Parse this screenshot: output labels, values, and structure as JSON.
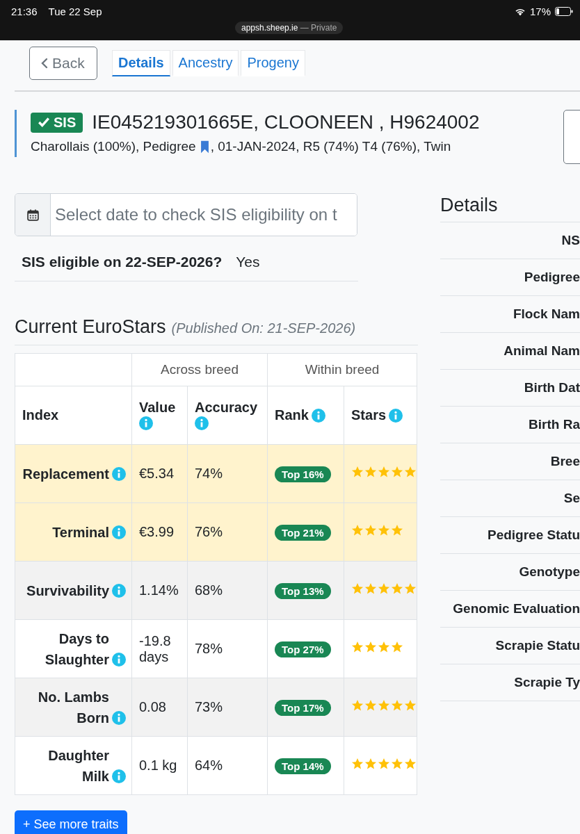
{
  "status_bar": {
    "time": "21:36",
    "date": "Tue 22 Sep",
    "battery": "17%",
    "url": "appsh.sheep.ie",
    "url_note": "— Private"
  },
  "nav": {
    "back": "Back",
    "tabs": [
      {
        "label": "Details",
        "selected": true
      },
      {
        "label": "Ancestry",
        "selected": false
      },
      {
        "label": "Progeny",
        "selected": false
      }
    ]
  },
  "animal": {
    "badge": "SIS",
    "title": "IE045219301665E, CLOONEEN , H9624002",
    "summary_before": "Charollais (100%), Pedigree",
    "summary_after": ", 01-JAN-2024, R5 (74%) T4 (76%), Twin"
  },
  "date_field": {
    "placeholder": "Select date to check SIS eligibility on t"
  },
  "eligibility": {
    "label": "SIS eligible on 22-SEP-2026?",
    "value": "Yes"
  },
  "eurostars": {
    "title": "Current EuroStars",
    "published": "(Published On: 21-SEP-2026)",
    "groups": [
      "Across breed",
      "Within breed"
    ],
    "columns": [
      "Index",
      "Value",
      "Accuracy",
      "Rank",
      "Stars"
    ],
    "rows": [
      {
        "index": "Replacement",
        "value": "€5.34",
        "accuracy": "74%",
        "rank": "Top 16%",
        "stars": 5,
        "highlighted": true
      },
      {
        "index": "Terminal",
        "value": "€3.99",
        "accuracy": "76%",
        "rank": "Top 21%",
        "stars": 4,
        "highlighted": true
      },
      {
        "index": "Survivability",
        "value": "1.14%",
        "accuracy": "68%",
        "rank": "Top 13%",
        "stars": 5,
        "highlighted": false
      },
      {
        "index": "Days to Slaughter",
        "value": "-19.8 days",
        "accuracy": "78%",
        "rank": "Top 27%",
        "stars": 4,
        "highlighted": false
      },
      {
        "index": "No. Lambs Born",
        "value": "0.08",
        "accuracy": "73%",
        "rank": "Top 17%",
        "stars": 5,
        "highlighted": false
      },
      {
        "index": "Daughter Milk",
        "value": "0.1 kg",
        "accuracy": "64%",
        "rank": "Top 14%",
        "stars": 5,
        "highlighted": false
      }
    ],
    "more_button": "+ See more traits"
  },
  "details": {
    "title": "Details",
    "labels": [
      "NS",
      "Pedigree",
      "Flock Nam",
      "Animal Nam",
      "Birth Dat",
      "Birth Ra",
      "Bree",
      "Se",
      "Pedigree Statu",
      "Genotype",
      "Genomic Evaluation",
      "Scrapie Statu",
      "Scrapie Ty"
    ]
  }
}
